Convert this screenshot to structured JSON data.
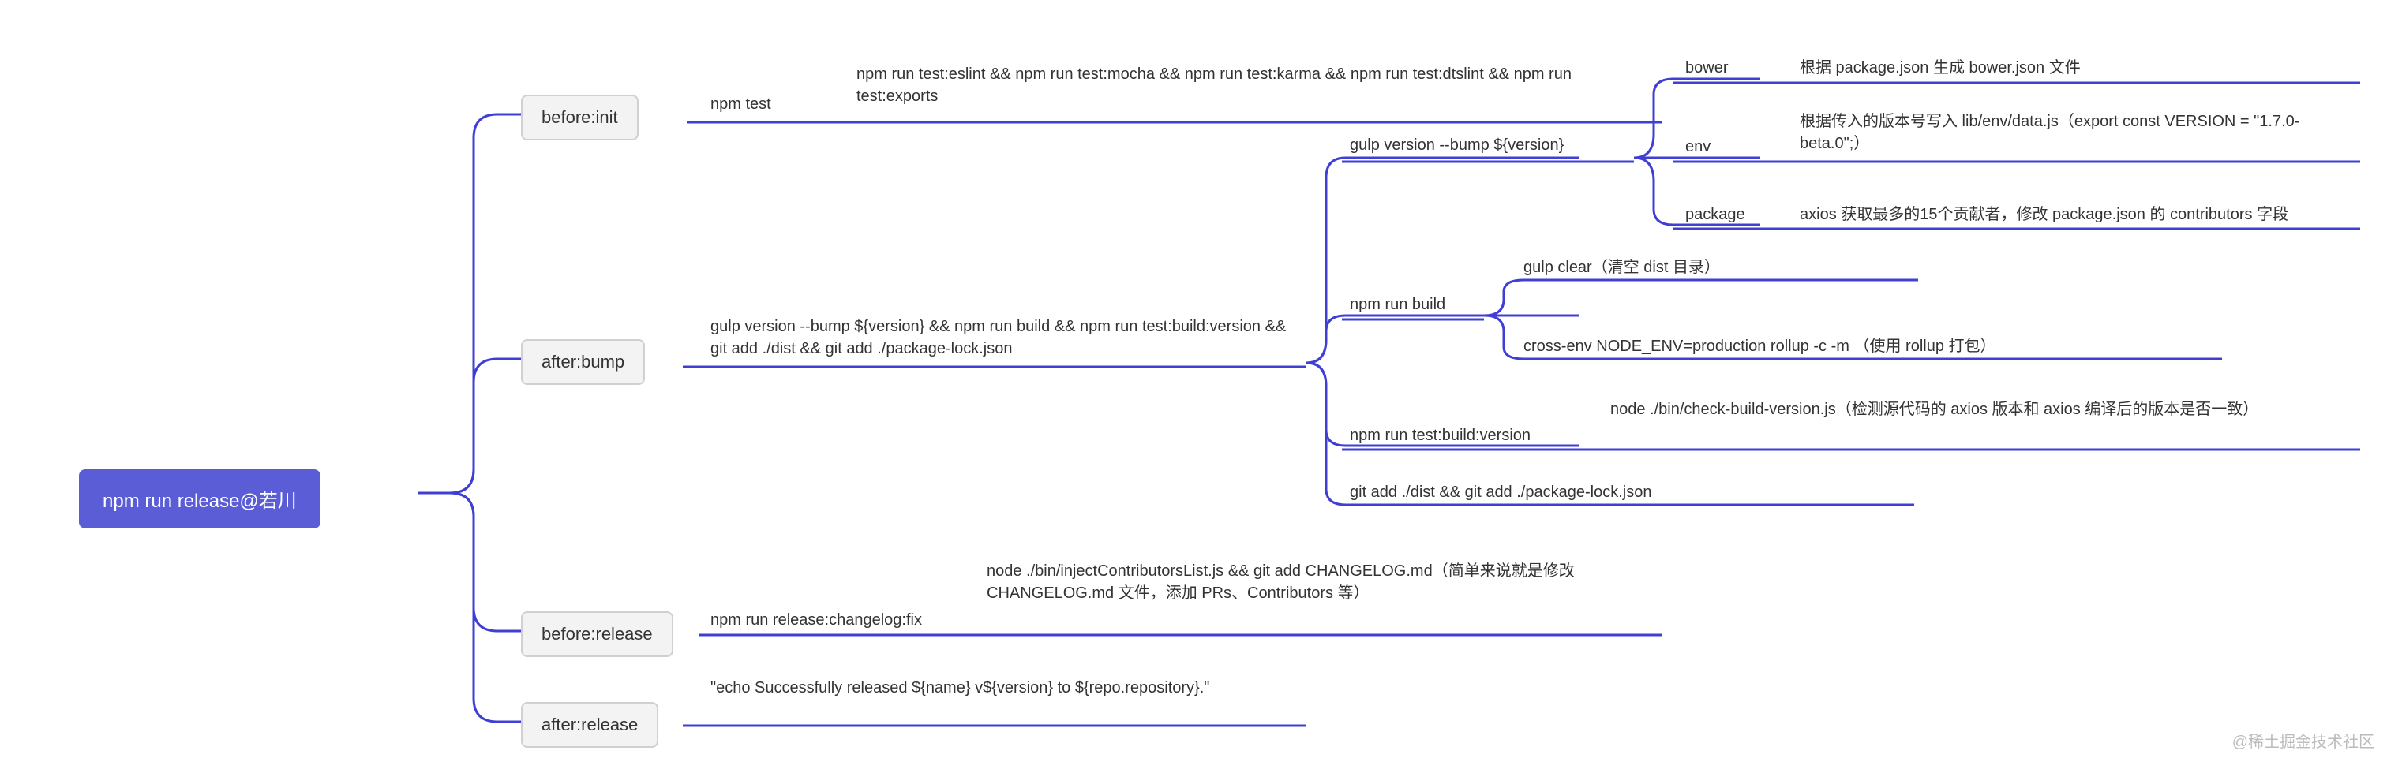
{
  "root": "npm run release@若川",
  "watermark": "@稀土掘金技术社区",
  "stages": {
    "before_init": "before:init",
    "after_bump": "after:bump",
    "before_release": "before:release",
    "after_release": "after:release"
  },
  "labels": {
    "npm_test": "npm test",
    "npm_test_detail": "npm run test:eslint && npm run test:mocha && npm run test:karma && npm run test:dtslint && npm run test:exports",
    "after_bump_cmd": "gulp version --bump ${version} && npm run build && npm run test:build:version && git add ./dist && git add ./package-lock.json",
    "gulp_version": "gulp version --bump ${version}",
    "bower": "bower",
    "bower_desc": "根据 package.json 生成 bower.json 文件",
    "env": "env",
    "env_desc": "根据传入的版本号写入 lib/env/data.js（export const VERSION = \"1.7.0-beta.0\";）",
    "package": "package",
    "package_desc": "axios 获取最多的15个贡献者，修改 package.json 的 contributors 字段",
    "npm_run_build": "npm run build",
    "build_clear": "gulp clear（清空 dist 目录）",
    "build_rollup": "cross-env NODE_ENV=production rollup -c -m （使用 rollup 打包）",
    "test_build_version": "npm run test:build:version",
    "test_build_version_desc": "node ./bin/check-build-version.js（检测源代码的 axios 版本和 axios 编译后的版本是否一致）",
    "git_add": "git add ./dist && git add ./package-lock.json",
    "release_changelog": "npm run release:changelog:fix",
    "release_changelog_desc": "node ./bin/injectContributorsList.js && git add CHANGELOG.md（简单来说就是修改 CHANGELOG.md 文件，添加 PRs、Contributors 等）",
    "after_release_cmd": "\"echo Successfully released ${name} v${version} to ${repo.repository}.\""
  },
  "chart_data": {
    "type": "mindmap",
    "root": "npm run release@若川",
    "children": [
      {
        "name": "before:init",
        "label": "npm test",
        "children": [
          {
            "name": "npm run test:eslint && npm run test:mocha && npm run test:karma && npm run test:dtslint && npm run test:exports"
          }
        ]
      },
      {
        "name": "after:bump",
        "label": "gulp version --bump ${version} && npm run build && npm run test:build:version && git add ./dist && git add ./package-lock.json",
        "children": [
          {
            "name": "gulp version --bump ${version}",
            "children": [
              {
                "name": "bower",
                "desc": "根据 package.json 生成 bower.json 文件"
              },
              {
                "name": "env",
                "desc": "根据传入的版本号写入 lib/env/data.js（export const VERSION = \"1.7.0-beta.0\";）"
              },
              {
                "name": "package",
                "desc": "axios 获取最多的15个贡献者，修改 package.json 的 contributors 字段"
              }
            ]
          },
          {
            "name": "npm run build",
            "children": [
              {
                "name": "gulp clear（清空 dist 目录）"
              },
              {
                "name": "cross-env NODE_ENV=production rollup -c -m （使用 rollup 打包）"
              }
            ]
          },
          {
            "name": "npm run test:build:version",
            "desc": "node ./bin/check-build-version.js（检测源代码的 axios 版本和 axios 编译后的版本是否一致）"
          },
          {
            "name": "git add ./dist && git add ./package-lock.json"
          }
        ]
      },
      {
        "name": "before:release",
        "label": "npm run release:changelog:fix",
        "children": [
          {
            "name": "node ./bin/injectContributorsList.js && git add CHANGELOG.md（简单来说就是修改 CHANGELOG.md 文件，添加 PRs、Contributors 等）"
          }
        ]
      },
      {
        "name": "after:release",
        "label": "\"echo Successfully released ${name} v${version} to ${repo.repository}.\""
      }
    ]
  }
}
